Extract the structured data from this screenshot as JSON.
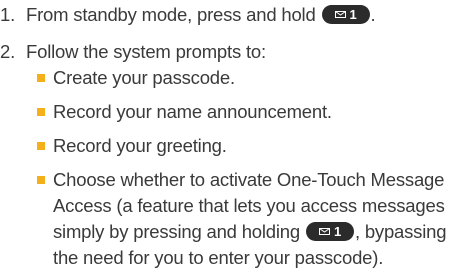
{
  "colors": {
    "bullet": "#f3b01b",
    "key": "#2b2b2b",
    "text": "#3a3a3a"
  },
  "key": {
    "icon": "envelope-icon",
    "label": "1"
  },
  "steps": [
    {
      "number": "1.",
      "text_before": "From standby mode, press and hold",
      "text_after": "."
    },
    {
      "number": "2.",
      "text": "Follow the system prompts to:"
    }
  ],
  "bullets": [
    "Create your passcode.",
    "Record your name announcement.",
    "Record your greeting."
  ],
  "last_bullet": {
    "text_before": "Choose whether to activate One-Touch Message Access (a feature that lets you access messages simply by pressing and holding",
    "text_after": ", bypassing the need for you to enter your passcode)."
  }
}
